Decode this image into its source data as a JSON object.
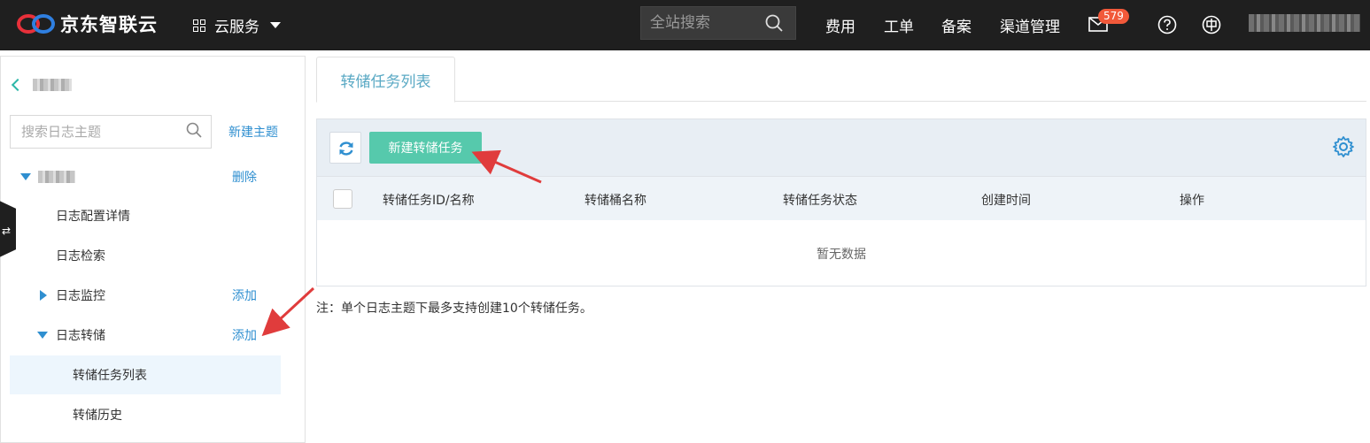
{
  "header": {
    "brand": "京东智联云",
    "service_menu": "云服务",
    "search_placeholder": "全站搜索",
    "nav": [
      "费用",
      "工单",
      "备案",
      "渠道管理"
    ],
    "mail_count": "579",
    "icons": [
      "mail-icon",
      "help-icon",
      "language-icon"
    ]
  },
  "sidebar": {
    "search_placeholder": "搜索日志主题",
    "new_topic": "新建主题",
    "delete": "删除",
    "items": [
      {
        "label": "日志配置详情"
      },
      {
        "label": "日志检索"
      },
      {
        "label": "日志监控",
        "action": "添加"
      },
      {
        "label": "日志转储",
        "action": "添加"
      },
      {
        "label": "转储任务列表"
      },
      {
        "label": "转储历史"
      }
    ]
  },
  "main": {
    "tab": "转储任务列表",
    "create_button": "新建转储任务",
    "columns": [
      "转储任务ID/名称",
      "转储桶名称",
      "转储任务状态",
      "创建时间",
      "操作"
    ],
    "empty_text": "暂无数据",
    "note": "注：单个日志主题下最多支持创建10个转储任务。"
  },
  "colors": {
    "header_bg": "#1f1f1f",
    "accent_green": "#56c9ac",
    "link_blue": "#2f8fd0",
    "arrow_red": "#e03c3c"
  }
}
